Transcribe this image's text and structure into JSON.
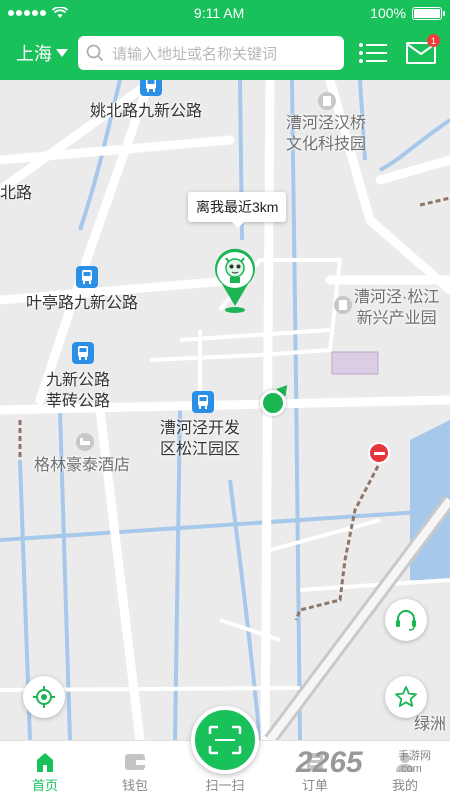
{
  "status": {
    "time": "9:11 AM",
    "battery": "100%"
  },
  "header": {
    "city": "上海",
    "search_placeholder": "请输入地址或名称关键词",
    "badge_count": "1"
  },
  "map": {
    "callout": "离我最近3km",
    "labels": {
      "yaobei": "姚北路九新公路",
      "caohejing_hanqiao": "漕河泾汉桥\n文化科技园",
      "north_road": "北路",
      "yeting": "叶亭路九新公路",
      "caohejing_songjiang": "漕河泾·松江\n新兴产业园",
      "jiuxin": "九新公路\n莘砖公路",
      "caohejing_dev": "漕河泾开发\n区松江园区",
      "gelin_hotel": "格林豪泰酒店",
      "lvzhou": "绿洲"
    }
  },
  "nav": {
    "items": [
      {
        "label": "首页",
        "icon": "home-icon",
        "active": true
      },
      {
        "label": "钱包",
        "icon": "wallet-icon",
        "active": false
      },
      {
        "label": "扫一扫",
        "icon": "scan-icon",
        "active": false
      },
      {
        "label": "订单",
        "icon": "orders-icon",
        "active": false
      },
      {
        "label": "我的",
        "icon": "profile-icon",
        "active": false
      }
    ]
  },
  "watermark": {
    "text": "2265",
    "sub": "手游网\n.com"
  },
  "colors": {
    "brand": "#19c15b",
    "bus": "#2b8fe6",
    "alert": "#e7353b"
  }
}
